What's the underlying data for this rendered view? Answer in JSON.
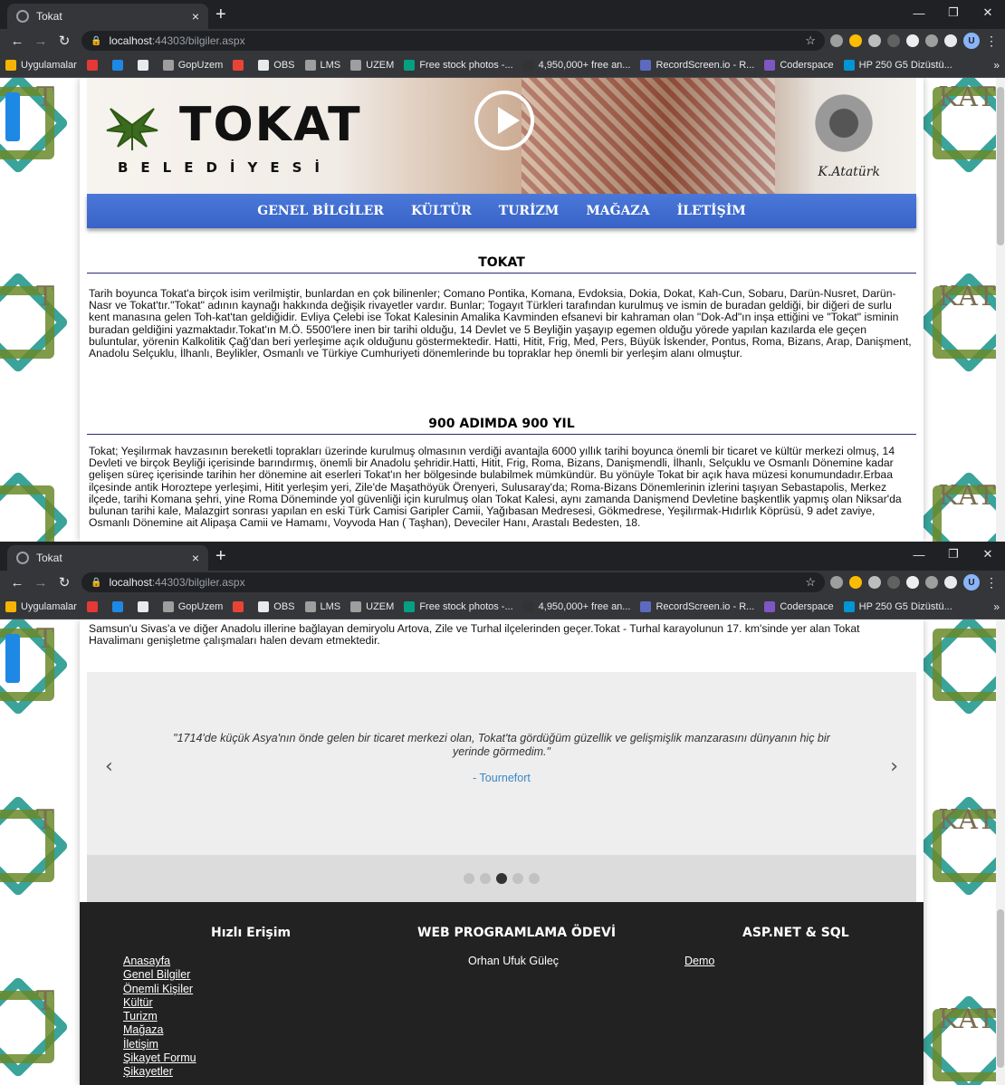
{
  "browser": {
    "tab_title": "Tokat",
    "tab_close": "×",
    "new_tab": "+",
    "url_host": "localhost",
    "url_path": ":44303/bilgiler.aspx",
    "profile_initial": "U",
    "window_controls": [
      "—",
      "❐",
      "✕"
    ],
    "bookmarks": [
      {
        "label": "Uygulamalar",
        "color": "#f4b400"
      },
      {
        "label": "",
        "color": "#e53935"
      },
      {
        "label": "",
        "color": "#1e88e5"
      },
      {
        "label": "",
        "color": "#e8eaed"
      },
      {
        "label": "GopUzem",
        "color": "#9e9e9e"
      },
      {
        "label": "",
        "color": "#ea4335"
      },
      {
        "label": "OBS",
        "color": "#e8eaed"
      },
      {
        "label": "LMS",
        "color": "#9e9e9e"
      },
      {
        "label": "UZEM",
        "color": "#9e9e9e"
      },
      {
        "label": "Free stock photos -...",
        "color": "#05a081"
      },
      {
        "label": "4,950,000+ free an...",
        "color": "#333333"
      },
      {
        "label": "RecordScreen.io - R...",
        "color": "#5c6bc0"
      },
      {
        "label": "Coderspace",
        "color": "#7e57c2"
      },
      {
        "label": "HP 250 G5 Dizüstü...",
        "color": "#0096d6"
      }
    ],
    "bookmarks_more": "»"
  },
  "header": {
    "logo_title": "TOKAT",
    "logo_subtitle": "BELEDİYESİ",
    "signature": "K.Atatürk"
  },
  "nav": {
    "items": [
      "GENEL BİLGİLER",
      "KÜLTÜR",
      "TURİZM",
      "MAĞAZA",
      "İLETİŞİM"
    ]
  },
  "sections": {
    "tokat_title": "TOKAT",
    "tokat_text": "Tarih boyunca Tokat'a birçok isim verilmiştir, bunlardan en çok bilinenler; Comano Pontika, Komana, Evdoksia, Dokia, Dokat, Kah-Cun, Sobaru, Darün-Nusret, Darün-Nasr ve Tokat'tır.\"Tokat\" adının kaynağı hakkında değişik rivayetler vardır. Bunlar; Togayıt Türkleri tarafından kurulmuş ve ismin de buradan geldiği, bir diğeri de surlu kent manasına gelen Toh-kat'tan geldiğidir. Evliya Çelebi ise Tokat Kalesinin Amalika Kavminden efsanevi bir kahraman olan \"Dok-Ad\"ın inşa ettiğini ve \"Tokat\" isminin buradan geldiğini yazmaktadır.Tokat'ın M.Ö. 5500'lere inen bir tarihi olduğu, 14 Devlet ve 5 Beyliğin yaşayıp egemen olduğu yörede yapılan kazılarda ele geçen buluntular, yörenin Kalkolitik Çağ'dan beri yerleşime açık olduğunu göstermektedir. Hatti, Hitit, Frig, Med, Pers, Büyük İskender, Pontus, Roma, Bizans, Arap, Danişment, Anadolu Selçuklu, İlhanlı, Beylikler, Osmanlı ve Türkiye Cumhuriyeti dönemlerinde bu topraklar hep önemli bir yerleşim alanı olmuştur.",
    "yil_title": "900 ADIMDA 900 YIL",
    "yil_text": "Tokat; Yeşilırmak havzasının bereketli toprakları üzerinde kurulmuş olmasının verdiği avantajla 6000 yıllık tarihi boyunca önemli bir ticaret ve kültür merkezi olmuş, 14 Devleti ve birçok Beyliği içerisinde barındırmış, önemli bir Anadolu şehridir.Hatti, Hitit, Frig, Roma, Bizans, Danişmendli, İlhanlı, Selçuklu ve Osmanlı Dönemine kadar gelişen süreç içerisinde tarihin her dönemine ait eserleri Tokat'ın her bölgesinde bulabilmek mümkündür. Bu yönüyle Tokat bir açık hava müzesi konumundadır.Erbaa ilçesinde antik Horoztepe yerleşimi, Hitit yerleşim yeri, Zile'de Maşathöyük Örenyeri, Sulusaray'da; Roma-Bizans Dönemlerinin izlerini taşıyan Sebastapolis, Merkez ilçede, tarihi Komana şehri, yine Roma Döneminde yol güvenliği için kurulmuş olan Tokat Kalesi, aynı zamanda Danişmend Devletine başkentlik yapmış olan Niksar'da bulunan tarihi kale, Malazgirt sonrası yapılan en eski Türk Camisi Garipler Camii, Yağıbasan Medresesi, Gökmedrese, Yeşilırmak-Hıdırlık Köprüsü, 9 adet zaviye, Osmanlı Dönemine ait Alipaşa Camii ve Hamamı, Voyvoda Han ( Taşhan), Deveciler Hanı, Arastalı Bedesten, 18.",
    "transport_text": "Samsun'u Sivas'a ve diğer Anadolu illerine bağlayan demiryolu Artova, Zile ve Turhal ilçelerinden geçer.Tokat - Turhal karayolunun 17. km'sinde yer alan Tokat Havalimanı genişletme çalışmaları halen devam etmektedir."
  },
  "carousel": {
    "quote": "\"1714'de küçük Asya'nın önde gelen bir ticaret merkezi olan, Tokat'ta gördüğüm güzellik ve gelişmişlik manzarasını dünyanın hiç bir yerinde görmedim.\"",
    "author": "- Tournefort",
    "prev": "‹",
    "next": "›",
    "slide_count": 5,
    "active_index": 2
  },
  "footer": {
    "col1_title": "Hızlı Erişim",
    "col1_links": [
      "Anasayfa",
      "Genel Bilgiler",
      "Önemli Kişiler",
      "Kültür",
      "Turizm",
      "Mağaza",
      "İletişim",
      "Şikayet Formu",
      "Şikayetler"
    ],
    "col2_title": "WEB PROGRAMLAMA ÖDEVİ",
    "col2_name": "Orhan Ufuk Güleç",
    "col3_title": "ASP.NET & SQL",
    "col3_link": "Demo"
  }
}
